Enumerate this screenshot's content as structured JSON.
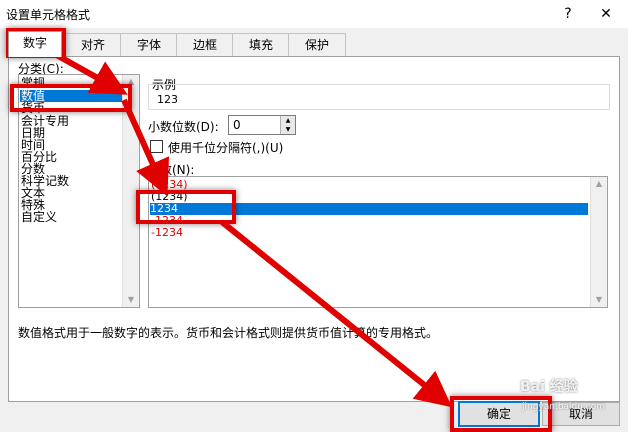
{
  "window": {
    "title": "设置单元格格式",
    "help_glyph": "?",
    "close_glyph": "✕"
  },
  "tabs": [
    "数字",
    "对齐",
    "字体",
    "边框",
    "填充",
    "保护"
  ],
  "category": {
    "label": "分类(C):",
    "items": [
      "常规",
      "数值",
      "货币",
      "会计专用",
      "日期",
      "时间",
      "百分比",
      "分数",
      "科学记数",
      "文本",
      "特殊",
      "自定义"
    ],
    "selected": "数值"
  },
  "sample": {
    "label": "示例",
    "value": "123"
  },
  "decimal_places": {
    "label": "小数位数(D):",
    "value": "0"
  },
  "thousands_separator": {
    "label": "使用千位分隔符(,)(U)",
    "checked": false
  },
  "negative_numbers": {
    "label": "负数(N):",
    "items": [
      {
        "text": "(1234)",
        "color": "#e00000"
      },
      {
        "text": "(1234)",
        "color": "#000000"
      },
      {
        "text": "1234",
        "color": "#ffffff"
      },
      {
        "text": "-1234",
        "color": "#e00000"
      },
      {
        "text": "-1234",
        "color": "#e00000"
      }
    ],
    "selected_index": 2
  },
  "description": "数值格式用于一般数字的表示。货币和会计格式则提供货币值计算的专用格式。",
  "buttons": {
    "ok": "确定",
    "cancel": "取消"
  },
  "watermark": {
    "brand": "Bai 经验",
    "url": "jingyan.baidu.com"
  },
  "colors": {
    "accent": "#0078d7",
    "annotation": "#e00000"
  }
}
